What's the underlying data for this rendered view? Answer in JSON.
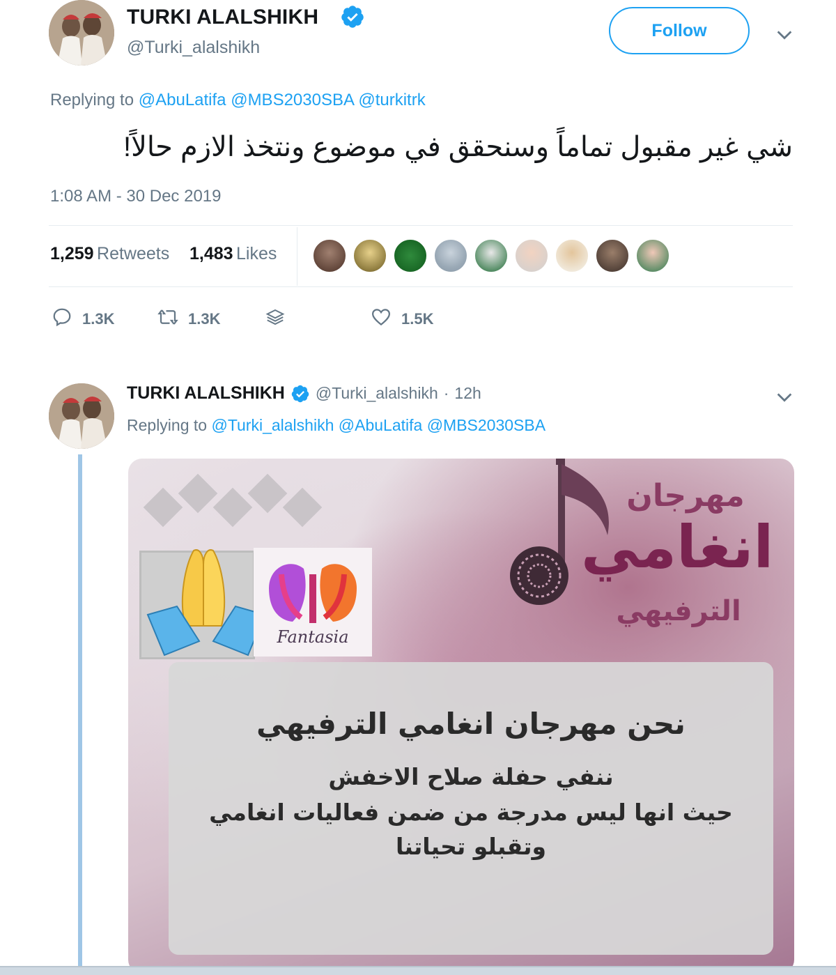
{
  "tweet1": {
    "name": "TURKI ALALSHIKH",
    "handle": "@Turki_alalshikh",
    "follow_label": "Follow",
    "replying_prefix": "Replying to",
    "mentions": [
      "@AbuLatifa",
      "@MBS2030SBA",
      "@turkitrk"
    ],
    "text": "شي غير مقبول تماماً وسنحقق في موضوع ونتخذ الازم حالاً!",
    "timestamp": "1:08 AM - 30 Dec 2019",
    "retweets_count": "1,259",
    "retweets_label": "Retweets",
    "likes_count": "1,483",
    "likes_label": "Likes",
    "actions": {
      "replies": "1.3K",
      "retweets": "1.3K",
      "likes": "1.5K"
    }
  },
  "tweet2": {
    "name": "TURKI ALALSHIKH",
    "handle": "@Turki_alalshikh",
    "dot": "·",
    "age": "12h",
    "replying_prefix": "Replying to",
    "mentions": [
      "@Turki_alalshikh",
      "@AbuLatifa",
      "@MBS2030SBA"
    ],
    "image": {
      "festival_title_1": "مهرجان",
      "festival_title_2": "انغامي",
      "festival_title_3": "الترفيهي",
      "brand": "Fantasia",
      "line1": "نحن مهرجان انغامي الترفيهي",
      "line2": "ننفي حفلة صلاح الاخفش",
      "line3": "حيث انها ليس مدرجة من ضمن  فعاليات انغامي",
      "line4": "وتقبلو تحياتنا"
    }
  },
  "colors": {
    "accent": "#1da1f2",
    "muted": "#657786",
    "divider": "#e6ecf0"
  },
  "icons": [
    "verified-icon",
    "chevron-down-icon",
    "reply-icon",
    "retweet-icon",
    "stack-icon",
    "heart-icon",
    "praying-hands-icon"
  ]
}
